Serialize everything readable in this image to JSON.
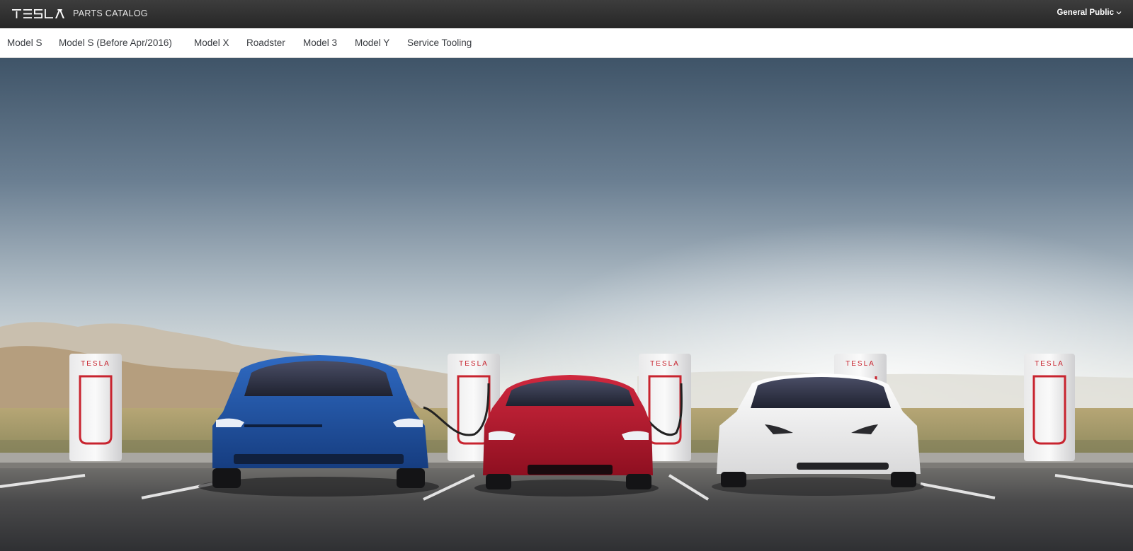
{
  "header": {
    "brand_logo": "tesla-wordmark",
    "title": "PARTS CATALOG",
    "audience_selector": "General Public",
    "audience_icon": "chevron-down-icon"
  },
  "nav": {
    "items": [
      {
        "label": "Model S"
      },
      {
        "label": "Model S (Before Apr/2016)"
      },
      {
        "label": "Model X"
      },
      {
        "label": "Roadster"
      },
      {
        "label": "Model 3"
      },
      {
        "label": "Model Y"
      },
      {
        "label": "Service Tooling"
      }
    ]
  },
  "hero": {
    "charger_brand_text": "TESLA",
    "colors": {
      "sky_top": "#3f5468",
      "sky_horizon": "#f4f1ea",
      "car_blue": "#1f4f9c",
      "car_red": "#b3142a",
      "car_white": "#f2f2f2",
      "asphalt": "#3c3d40"
    }
  }
}
